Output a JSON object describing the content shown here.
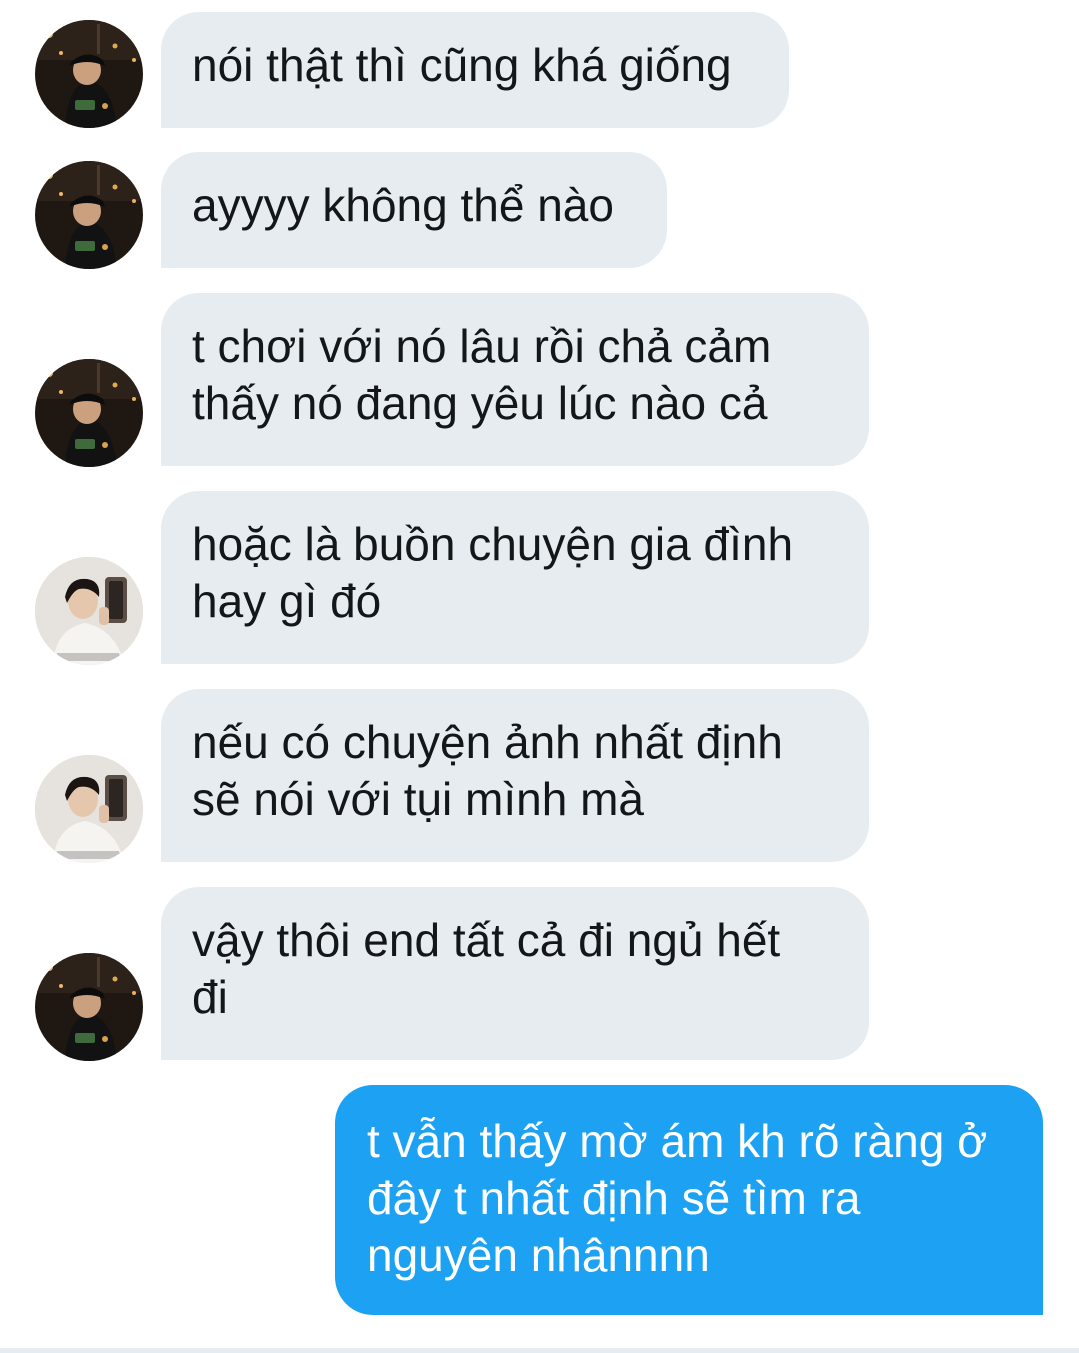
{
  "conversation": {
    "messages": [
      {
        "sender": "friend-dark",
        "avatar_icon": "avatar-dark-cap-icon",
        "lines": [
          "nói thật thì cũng khá giống"
        ]
      },
      {
        "sender": "friend-dark",
        "avatar_icon": "avatar-dark-cap-icon",
        "lines": [
          "ayyyy không thể nào"
        ]
      },
      {
        "sender": "friend-dark",
        "avatar_icon": "avatar-dark-cap-icon",
        "lines": [
          "t chơi với nó lâu rồi chả cảm",
          "thấy nó đang yêu lúc nào cả"
        ]
      },
      {
        "sender": "friend-light",
        "avatar_icon": "avatar-light-selfie-icon",
        "lines": [
          "hoặc là buồn chuyện gia đình",
          "hay gì đó"
        ]
      },
      {
        "sender": "friend-light",
        "avatar_icon": "avatar-light-selfie-icon",
        "lines": [
          "nếu có chuyện ảnh nhất định",
          "sẽ nói với tụi mình mà"
        ]
      },
      {
        "sender": "friend-dark",
        "avatar_icon": "avatar-dark-cap-icon",
        "lines": [
          "vậy thôi end tất cả đi ngủ hết",
          "đi"
        ]
      },
      {
        "sender": "me",
        "lines": [
          "t vẫn thấy mờ ám kh rõ ràng ở",
          "đây t nhất định sẽ tìm ra",
          "nguyên nhânnnn"
        ]
      }
    ]
  },
  "colors": {
    "incoming_bubble": "#e6ecf0",
    "outgoing_bubble": "#1da1f2",
    "incoming_text": "#14171a",
    "outgoing_text": "#ffffff"
  }
}
